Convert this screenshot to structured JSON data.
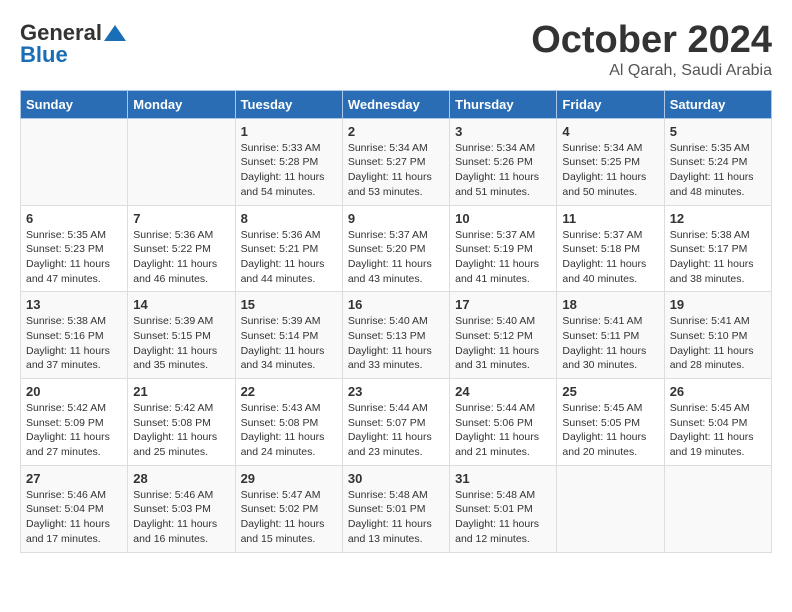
{
  "header": {
    "logo_general": "General",
    "logo_blue": "Blue",
    "month_title": "October 2024",
    "location": "Al Qarah, Saudi Arabia"
  },
  "days_of_week": [
    "Sunday",
    "Monday",
    "Tuesday",
    "Wednesday",
    "Thursday",
    "Friday",
    "Saturday"
  ],
  "weeks": [
    [
      {
        "day": "",
        "info": ""
      },
      {
        "day": "",
        "info": ""
      },
      {
        "day": "1",
        "info": "Sunrise: 5:33 AM\nSunset: 5:28 PM\nDaylight: 11 hours and 54 minutes."
      },
      {
        "day": "2",
        "info": "Sunrise: 5:34 AM\nSunset: 5:27 PM\nDaylight: 11 hours and 53 minutes."
      },
      {
        "day": "3",
        "info": "Sunrise: 5:34 AM\nSunset: 5:26 PM\nDaylight: 11 hours and 51 minutes."
      },
      {
        "day": "4",
        "info": "Sunrise: 5:34 AM\nSunset: 5:25 PM\nDaylight: 11 hours and 50 minutes."
      },
      {
        "day": "5",
        "info": "Sunrise: 5:35 AM\nSunset: 5:24 PM\nDaylight: 11 hours and 48 minutes."
      }
    ],
    [
      {
        "day": "6",
        "info": "Sunrise: 5:35 AM\nSunset: 5:23 PM\nDaylight: 11 hours and 47 minutes."
      },
      {
        "day": "7",
        "info": "Sunrise: 5:36 AM\nSunset: 5:22 PM\nDaylight: 11 hours and 46 minutes."
      },
      {
        "day": "8",
        "info": "Sunrise: 5:36 AM\nSunset: 5:21 PM\nDaylight: 11 hours and 44 minutes."
      },
      {
        "day": "9",
        "info": "Sunrise: 5:37 AM\nSunset: 5:20 PM\nDaylight: 11 hours and 43 minutes."
      },
      {
        "day": "10",
        "info": "Sunrise: 5:37 AM\nSunset: 5:19 PM\nDaylight: 11 hours and 41 minutes."
      },
      {
        "day": "11",
        "info": "Sunrise: 5:37 AM\nSunset: 5:18 PM\nDaylight: 11 hours and 40 minutes."
      },
      {
        "day": "12",
        "info": "Sunrise: 5:38 AM\nSunset: 5:17 PM\nDaylight: 11 hours and 38 minutes."
      }
    ],
    [
      {
        "day": "13",
        "info": "Sunrise: 5:38 AM\nSunset: 5:16 PM\nDaylight: 11 hours and 37 minutes."
      },
      {
        "day": "14",
        "info": "Sunrise: 5:39 AM\nSunset: 5:15 PM\nDaylight: 11 hours and 35 minutes."
      },
      {
        "day": "15",
        "info": "Sunrise: 5:39 AM\nSunset: 5:14 PM\nDaylight: 11 hours and 34 minutes."
      },
      {
        "day": "16",
        "info": "Sunrise: 5:40 AM\nSunset: 5:13 PM\nDaylight: 11 hours and 33 minutes."
      },
      {
        "day": "17",
        "info": "Sunrise: 5:40 AM\nSunset: 5:12 PM\nDaylight: 11 hours and 31 minutes."
      },
      {
        "day": "18",
        "info": "Sunrise: 5:41 AM\nSunset: 5:11 PM\nDaylight: 11 hours and 30 minutes."
      },
      {
        "day": "19",
        "info": "Sunrise: 5:41 AM\nSunset: 5:10 PM\nDaylight: 11 hours and 28 minutes."
      }
    ],
    [
      {
        "day": "20",
        "info": "Sunrise: 5:42 AM\nSunset: 5:09 PM\nDaylight: 11 hours and 27 minutes."
      },
      {
        "day": "21",
        "info": "Sunrise: 5:42 AM\nSunset: 5:08 PM\nDaylight: 11 hours and 25 minutes."
      },
      {
        "day": "22",
        "info": "Sunrise: 5:43 AM\nSunset: 5:08 PM\nDaylight: 11 hours and 24 minutes."
      },
      {
        "day": "23",
        "info": "Sunrise: 5:44 AM\nSunset: 5:07 PM\nDaylight: 11 hours and 23 minutes."
      },
      {
        "day": "24",
        "info": "Sunrise: 5:44 AM\nSunset: 5:06 PM\nDaylight: 11 hours and 21 minutes."
      },
      {
        "day": "25",
        "info": "Sunrise: 5:45 AM\nSunset: 5:05 PM\nDaylight: 11 hours and 20 minutes."
      },
      {
        "day": "26",
        "info": "Sunrise: 5:45 AM\nSunset: 5:04 PM\nDaylight: 11 hours and 19 minutes."
      }
    ],
    [
      {
        "day": "27",
        "info": "Sunrise: 5:46 AM\nSunset: 5:04 PM\nDaylight: 11 hours and 17 minutes."
      },
      {
        "day": "28",
        "info": "Sunrise: 5:46 AM\nSunset: 5:03 PM\nDaylight: 11 hours and 16 minutes."
      },
      {
        "day": "29",
        "info": "Sunrise: 5:47 AM\nSunset: 5:02 PM\nDaylight: 11 hours and 15 minutes."
      },
      {
        "day": "30",
        "info": "Sunrise: 5:48 AM\nSunset: 5:01 PM\nDaylight: 11 hours and 13 minutes."
      },
      {
        "day": "31",
        "info": "Sunrise: 5:48 AM\nSunset: 5:01 PM\nDaylight: 11 hours and 12 minutes."
      },
      {
        "day": "",
        "info": ""
      },
      {
        "day": "",
        "info": ""
      }
    ]
  ]
}
